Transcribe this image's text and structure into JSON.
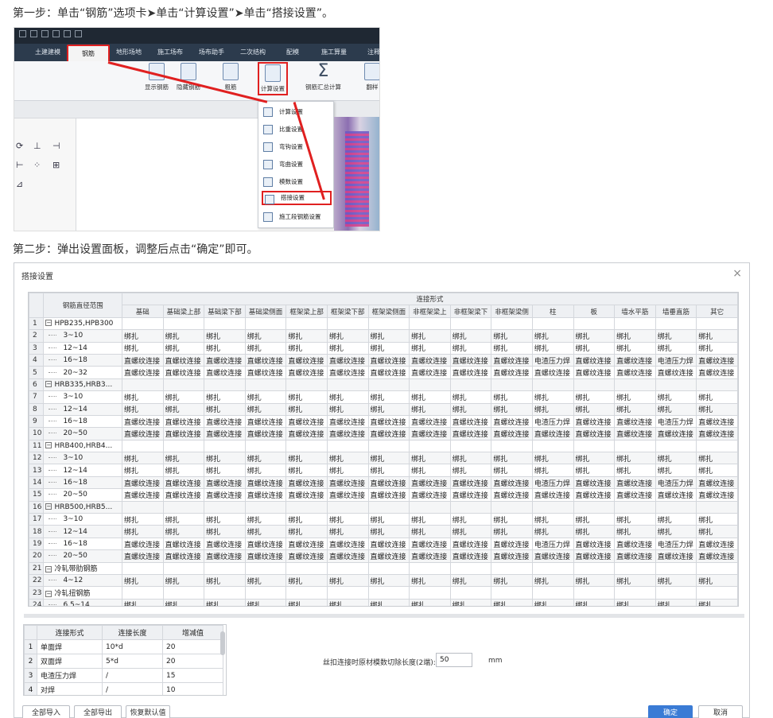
{
  "step1_text": "第一步：单击“钢筋”选项卡➤单击“计算设置”➤单击“搭接设置”。",
  "step2_text": "第二步：弹出设置面板，调整后点击“确定”即可。",
  "ribbon": {
    "tabs": [
      "土建建模",
      "钢筋",
      "地形场地",
      "施工场布",
      "场布助手",
      "二次结构",
      "配模",
      "施工算量",
      "注释"
    ],
    "active_tab": "钢筋",
    "buttons": [
      "显示钢筋",
      "隐藏钢筋",
      "粗筋",
      "计算设置",
      "钢筋汇总计算",
      "翻样"
    ],
    "highlighted_button": "计算设置",
    "dropdown_items": [
      "计算设置",
      "比重设置",
      "弯钩设置",
      "弯曲设置",
      "模数设置",
      "搭接设置",
      "施工段钢筋设置"
    ],
    "highlighted_item": "搭接设置",
    "accent_color": "#e02020"
  },
  "dialog": {
    "title": "搭接设置",
    "close": "×",
    "range_header": "钢筋直径范围",
    "group_header": "连接形式",
    "columns": [
      "基础",
      "基础梁上部",
      "基础梁下部",
      "基础梁侧面",
      "框架梁上部",
      "框架梁下部",
      "框架梁侧面",
      "非框架梁上",
      "非框架梁下",
      "非框架梁侧",
      "柱",
      "板",
      "墙水平筋",
      "墙垂直筋",
      "其它"
    ],
    "rows": [
      {
        "n": "1",
        "type": "group",
        "label": "HPB235,HPB300",
        "cells": []
      },
      {
        "n": "2",
        "type": "item",
        "label": "3~10",
        "cells": [
          "绑扎",
          "绑扎",
          "绑扎",
          "绑扎",
          "绑扎",
          "绑扎",
          "绑扎",
          "绑扎",
          "绑扎",
          "绑扎",
          "绑扎",
          "绑扎",
          "绑扎",
          "绑扎",
          "绑扎"
        ]
      },
      {
        "n": "3",
        "type": "item",
        "label": "12~14",
        "cells": [
          "绑扎",
          "绑扎",
          "绑扎",
          "绑扎",
          "绑扎",
          "绑扎",
          "绑扎",
          "绑扎",
          "绑扎",
          "绑扎",
          "绑扎",
          "绑扎",
          "绑扎",
          "绑扎",
          "绑扎"
        ]
      },
      {
        "n": "4",
        "type": "item",
        "label": "16~18",
        "cells": [
          "直螺纹连接",
          "直螺纹连接",
          "直螺纹连接",
          "直螺纹连接",
          "直螺纹连接",
          "直螺纹连接",
          "直螺纹连接",
          "直螺纹连接",
          "直螺纹连接",
          "直螺纹连接",
          "电渣压力焊",
          "直螺纹连接",
          "直螺纹连接",
          "电渣压力焊",
          "直螺纹连接"
        ]
      },
      {
        "n": "5",
        "type": "item",
        "label": "20~32",
        "cells": [
          "直螺纹连接",
          "直螺纹连接",
          "直螺纹连接",
          "直螺纹连接",
          "直螺纹连接",
          "直螺纹连接",
          "直螺纹连接",
          "直螺纹连接",
          "直螺纹连接",
          "直螺纹连接",
          "直螺纹连接",
          "直螺纹连接",
          "直螺纹连接",
          "直螺纹连接",
          "直螺纹连接"
        ]
      },
      {
        "n": "6",
        "type": "group",
        "label": "HRB335,HRB3...",
        "cells": []
      },
      {
        "n": "7",
        "type": "item",
        "label": "3~10",
        "cells": [
          "绑扎",
          "绑扎",
          "绑扎",
          "绑扎",
          "绑扎",
          "绑扎",
          "绑扎",
          "绑扎",
          "绑扎",
          "绑扎",
          "绑扎",
          "绑扎",
          "绑扎",
          "绑扎",
          "绑扎"
        ]
      },
      {
        "n": "8",
        "type": "item",
        "label": "12~14",
        "cells": [
          "绑扎",
          "绑扎",
          "绑扎",
          "绑扎",
          "绑扎",
          "绑扎",
          "绑扎",
          "绑扎",
          "绑扎",
          "绑扎",
          "绑扎",
          "绑扎",
          "绑扎",
          "绑扎",
          "绑扎"
        ]
      },
      {
        "n": "9",
        "type": "item",
        "label": "16~18",
        "cells": [
          "直螺纹连接",
          "直螺纹连接",
          "直螺纹连接",
          "直螺纹连接",
          "直螺纹连接",
          "直螺纹连接",
          "直螺纹连接",
          "直螺纹连接",
          "直螺纹连接",
          "直螺纹连接",
          "电渣压力焊",
          "直螺纹连接",
          "直螺纹连接",
          "电渣压力焊",
          "直螺纹连接"
        ]
      },
      {
        "n": "10",
        "type": "item",
        "label": "20~50",
        "cells": [
          "直螺纹连接",
          "直螺纹连接",
          "直螺纹连接",
          "直螺纹连接",
          "直螺纹连接",
          "直螺纹连接",
          "直螺纹连接",
          "直螺纹连接",
          "直螺纹连接",
          "直螺纹连接",
          "直螺纹连接",
          "直螺纹连接",
          "直螺纹连接",
          "直螺纹连接",
          "直螺纹连接"
        ]
      },
      {
        "n": "11",
        "type": "group",
        "label": "HRB400,HRB4...",
        "cells": []
      },
      {
        "n": "12",
        "type": "item",
        "label": "3~10",
        "cells": [
          "绑扎",
          "绑扎",
          "绑扎",
          "绑扎",
          "绑扎",
          "绑扎",
          "绑扎",
          "绑扎",
          "绑扎",
          "绑扎",
          "绑扎",
          "绑扎",
          "绑扎",
          "绑扎",
          "绑扎"
        ]
      },
      {
        "n": "13",
        "type": "item",
        "label": "12~14",
        "cells": [
          "绑扎",
          "绑扎",
          "绑扎",
          "绑扎",
          "绑扎",
          "绑扎",
          "绑扎",
          "绑扎",
          "绑扎",
          "绑扎",
          "绑扎",
          "绑扎",
          "绑扎",
          "绑扎",
          "绑扎"
        ]
      },
      {
        "n": "14",
        "type": "item",
        "label": "16~18",
        "cells": [
          "直螺纹连接",
          "直螺纹连接",
          "直螺纹连接",
          "直螺纹连接",
          "直螺纹连接",
          "直螺纹连接",
          "直螺纹连接",
          "直螺纹连接",
          "直螺纹连接",
          "直螺纹连接",
          "电渣压力焊",
          "直螺纹连接",
          "直螺纹连接",
          "电渣压力焊",
          "直螺纹连接"
        ]
      },
      {
        "n": "15",
        "type": "item",
        "label": "20~50",
        "cells": [
          "直螺纹连接",
          "直螺纹连接",
          "直螺纹连接",
          "直螺纹连接",
          "直螺纹连接",
          "直螺纹连接",
          "直螺纹连接",
          "直螺纹连接",
          "直螺纹连接",
          "直螺纹连接",
          "直螺纹连接",
          "直螺纹连接",
          "直螺纹连接",
          "直螺纹连接",
          "直螺纹连接"
        ]
      },
      {
        "n": "16",
        "type": "group",
        "label": "HRB500,HRB5...",
        "cells": []
      },
      {
        "n": "17",
        "type": "item",
        "label": "3~10",
        "cells": [
          "绑扎",
          "绑扎",
          "绑扎",
          "绑扎",
          "绑扎",
          "绑扎",
          "绑扎",
          "绑扎",
          "绑扎",
          "绑扎",
          "绑扎",
          "绑扎",
          "绑扎",
          "绑扎",
          "绑扎"
        ]
      },
      {
        "n": "18",
        "type": "item",
        "label": "12~14",
        "cells": [
          "绑扎",
          "绑扎",
          "绑扎",
          "绑扎",
          "绑扎",
          "绑扎",
          "绑扎",
          "绑扎",
          "绑扎",
          "绑扎",
          "绑扎",
          "绑扎",
          "绑扎",
          "绑扎",
          "绑扎"
        ]
      },
      {
        "n": "19",
        "type": "item",
        "label": "16~18",
        "cells": [
          "直螺纹连接",
          "直螺纹连接",
          "直螺纹连接",
          "直螺纹连接",
          "直螺纹连接",
          "直螺纹连接",
          "直螺纹连接",
          "直螺纹连接",
          "直螺纹连接",
          "直螺纹连接",
          "电渣压力焊",
          "直螺纹连接",
          "直螺纹连接",
          "电渣压力焊",
          "直螺纹连接"
        ]
      },
      {
        "n": "20",
        "type": "item",
        "label": "20~50",
        "cells": [
          "直螺纹连接",
          "直螺纹连接",
          "直螺纹连接",
          "直螺纹连接",
          "直螺纹连接",
          "直螺纹连接",
          "直螺纹连接",
          "直螺纹连接",
          "直螺纹连接",
          "直螺纹连接",
          "直螺纹连接",
          "直螺纹连接",
          "直螺纹连接",
          "直螺纹连接",
          "直螺纹连接"
        ]
      },
      {
        "n": "21",
        "type": "group",
        "label": "冷轧带肋钢筋",
        "cells": []
      },
      {
        "n": "22",
        "type": "item",
        "label": "4~12",
        "cells": [
          "绑扎",
          "绑扎",
          "绑扎",
          "绑扎",
          "绑扎",
          "绑扎",
          "绑扎",
          "绑扎",
          "绑扎",
          "绑扎",
          "绑扎",
          "绑扎",
          "绑扎",
          "绑扎",
          "绑扎"
        ]
      },
      {
        "n": "23",
        "type": "group",
        "label": "冷轧扭钢筋",
        "cells": []
      },
      {
        "n": "24",
        "type": "item",
        "label": "6.5~14",
        "cells": [
          "绑扎",
          "绑扎",
          "绑扎",
          "绑扎",
          "绑扎",
          "绑扎",
          "绑扎",
          "绑扎",
          "绑扎",
          "绑扎",
          "绑扎",
          "绑扎",
          "绑扎",
          "绑扎",
          "绑扎"
        ]
      }
    ],
    "lap_table": {
      "headers": [
        "连接形式",
        "连接长度",
        "增减值"
      ],
      "rows": [
        {
          "n": "1",
          "cells": [
            "单面焊",
            "10*d",
            "20"
          ]
        },
        {
          "n": "2",
          "cells": [
            "双面焊",
            "5*d",
            "20"
          ]
        },
        {
          "n": "3",
          "cells": [
            "电渣压力焊",
            "/",
            "15"
          ]
        },
        {
          "n": "4",
          "cells": [
            "对焊",
            "/",
            "10"
          ]
        }
      ]
    },
    "trim_label": "丝扣连接时原材模数切除长度(2端):",
    "trim_value": "50",
    "trim_unit": "mm",
    "buttons": {
      "import_all": "全部导入",
      "export_all": "全部导出",
      "restore_default": "恢复默认值",
      "ok": "确定",
      "cancel": "取消"
    },
    "primary_color": "#3a7bd5"
  }
}
